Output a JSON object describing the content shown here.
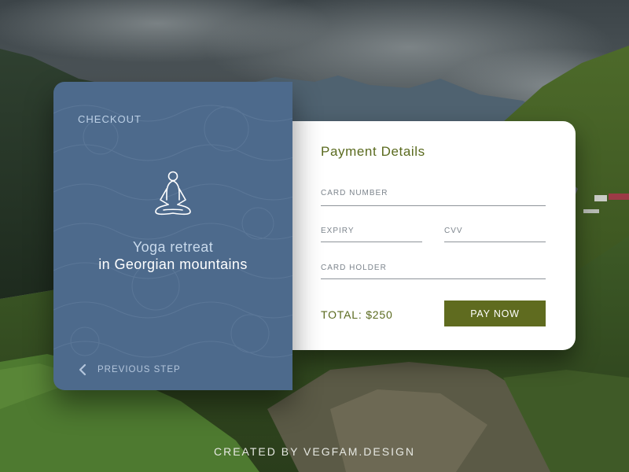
{
  "checkout": {
    "label": "CHECKOUT",
    "product_title": "Yoga retreat",
    "product_subtitle": "in Georgian mountains",
    "previous_step": "PREVIOUS STEP"
  },
  "payment": {
    "title": "Payment Details",
    "fields": {
      "card_number": {
        "label": "CARD NUMBER",
        "value": ""
      },
      "expiry": {
        "label": "EXPIRY",
        "value": ""
      },
      "cvv": {
        "label": "CVV",
        "value": ""
      },
      "card_holder": {
        "label": "CARD HOLDER",
        "value": ""
      }
    },
    "total": "TOTAL: $250",
    "pay_button": "PAY NOW"
  },
  "credit": "CREATED BY VEGFAM.DESIGN",
  "icons": {
    "product": "meditation-figure-icon",
    "back": "chevron-left-icon"
  },
  "colors": {
    "checkout_card": "#4d6a8c",
    "accent_olive": "#5f6b1f",
    "text_olive": "#5a6a1e",
    "payment_card": "#ffffff"
  }
}
